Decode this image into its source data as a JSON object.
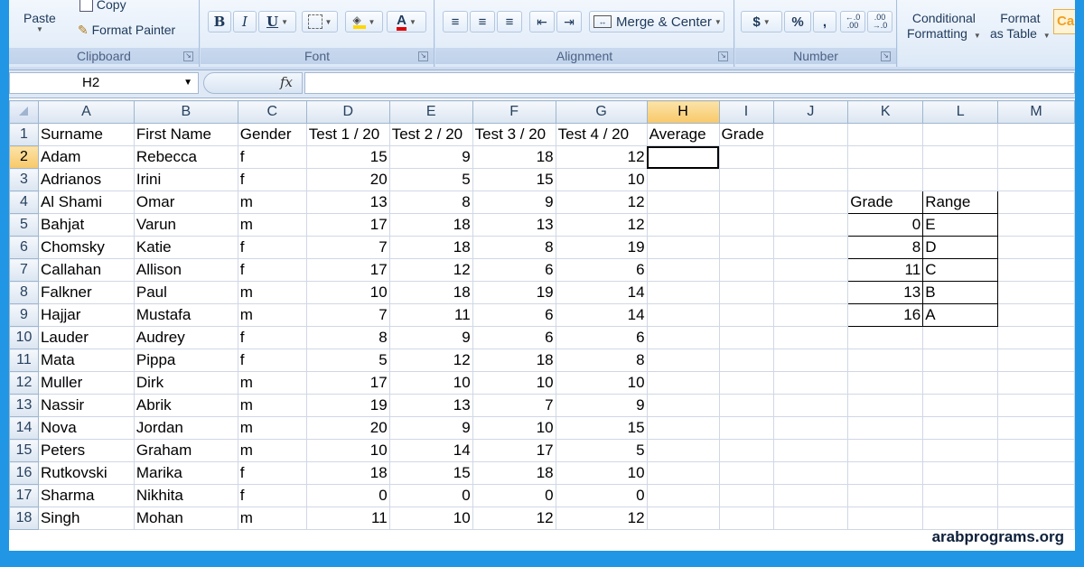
{
  "ribbon": {
    "clipboard": {
      "label": "Clipboard",
      "paste": "Paste",
      "copy": "Copy",
      "format_painter": "Format Painter"
    },
    "font": {
      "label": "Font",
      "bold": "B",
      "italic": "I",
      "underline": "U",
      "font_color_letter": "A",
      "font_color": "#e00000",
      "fill_color": "#ffd700"
    },
    "alignment": {
      "label": "Alignment",
      "merge_center": "Merge & Center"
    },
    "number": {
      "label": "Number",
      "currency": "$",
      "percent": "%",
      "comma": ",",
      "inc_decimal": "←.0 .00",
      "dec_decimal": ".00 →.0"
    },
    "styles": {
      "conditional_formatting": [
        "Conditional",
        "Formatting"
      ],
      "format_as_table": [
        "Format",
        "as Table"
      ],
      "cell_styles_partial": "Cal"
    }
  },
  "formula_bar": {
    "name_box": "H2",
    "fx": "fx",
    "formula": ""
  },
  "columns": [
    "A",
    "B",
    "C",
    "D",
    "E",
    "F",
    "G",
    "H",
    "I",
    "J",
    "K",
    "L",
    "M"
  ],
  "selected_column": "H",
  "selected_row": "2",
  "headers": [
    "Surname",
    "First Name",
    "Gender",
    "Test 1 / 20",
    "Test 2 / 20",
    "Test 3 / 20",
    "Test 4 / 20",
    "Average",
    "Grade"
  ],
  "rows": [
    {
      "n": "2",
      "surname": "Adam",
      "first": "Rebecca",
      "gender": "f",
      "t1": "15",
      "t2": "9",
      "t3": "18",
      "t4": "12"
    },
    {
      "n": "3",
      "surname": "Adrianos",
      "first": "Irini",
      "gender": "f",
      "t1": "20",
      "t2": "5",
      "t3": "15",
      "t4": "10"
    },
    {
      "n": "4",
      "surname": "Al Shami",
      "first": "Omar",
      "gender": "m",
      "t1": "13",
      "t2": "8",
      "t3": "9",
      "t4": "12"
    },
    {
      "n": "5",
      "surname": "Bahjat",
      "first": "Varun",
      "gender": "m",
      "t1": "17",
      "t2": "18",
      "t3": "13",
      "t4": "12"
    },
    {
      "n": "6",
      "surname": "Chomsky",
      "first": "Katie",
      "gender": "f",
      "t1": "7",
      "t2": "18",
      "t3": "8",
      "t4": "19"
    },
    {
      "n": "7",
      "surname": "Callahan",
      "first": "Allison",
      "gender": "f",
      "t1": "17",
      "t2": "12",
      "t3": "6",
      "t4": "6"
    },
    {
      "n": "8",
      "surname": "Falkner",
      "first": "Paul",
      "gender": "m",
      "t1": "10",
      "t2": "18",
      "t3": "19",
      "t4": "14"
    },
    {
      "n": "9",
      "surname": "Hajjar",
      "first": "Mustafa",
      "gender": "m",
      "t1": "7",
      "t2": "11",
      "t3": "6",
      "t4": "14"
    },
    {
      "n": "10",
      "surname": "Lauder",
      "first": "Audrey",
      "gender": "f",
      "t1": "8",
      "t2": "9",
      "t3": "6",
      "t4": "6"
    },
    {
      "n": "11",
      "surname": "Mata",
      "first": "Pippa",
      "gender": "f",
      "t1": "5",
      "t2": "12",
      "t3": "18",
      "t4": "8"
    },
    {
      "n": "12",
      "surname": "Muller",
      "first": "Dirk",
      "gender": "m",
      "t1": "17",
      "t2": "10",
      "t3": "10",
      "t4": "10"
    },
    {
      "n": "13",
      "surname": "Nassir",
      "first": "Abrik",
      "gender": "m",
      "t1": "19",
      "t2": "13",
      "t3": "7",
      "t4": "9"
    },
    {
      "n": "14",
      "surname": "Nova",
      "first": "Jordan",
      "gender": "m",
      "t1": "20",
      "t2": "9",
      "t3": "10",
      "t4": "15"
    },
    {
      "n": "15",
      "surname": "Peters",
      "first": "Graham",
      "gender": "m",
      "t1": "10",
      "t2": "14",
      "t3": "17",
      "t4": "5"
    },
    {
      "n": "16",
      "surname": "Rutkovski",
      "first": "Marika",
      "gender": "f",
      "t1": "18",
      "t2": "15",
      "t3": "18",
      "t4": "10"
    },
    {
      "n": "17",
      "surname": "Sharma",
      "first": "Nikhita",
      "gender": "f",
      "t1": "0",
      "t2": "0",
      "t3": "0",
      "t4": "0"
    },
    {
      "n": "18",
      "surname": "Singh",
      "first": "Mohan",
      "gender": "m",
      "t1": "11",
      "t2": "10",
      "t3": "12",
      "t4": "12"
    }
  ],
  "lookup": {
    "header_grade": "Grade",
    "header_range": "Range",
    "entries": [
      {
        "grade": "0",
        "range": "E"
      },
      {
        "grade": "8",
        "range": "D"
      },
      {
        "grade": "11",
        "range": "C"
      },
      {
        "grade": "13",
        "range": "B"
      },
      {
        "grade": "16",
        "range": "A"
      }
    ]
  },
  "watermark": "arabprograms.org",
  "colors": {
    "header_selected": "#f8c869",
    "page_border": "#2196e5"
  }
}
